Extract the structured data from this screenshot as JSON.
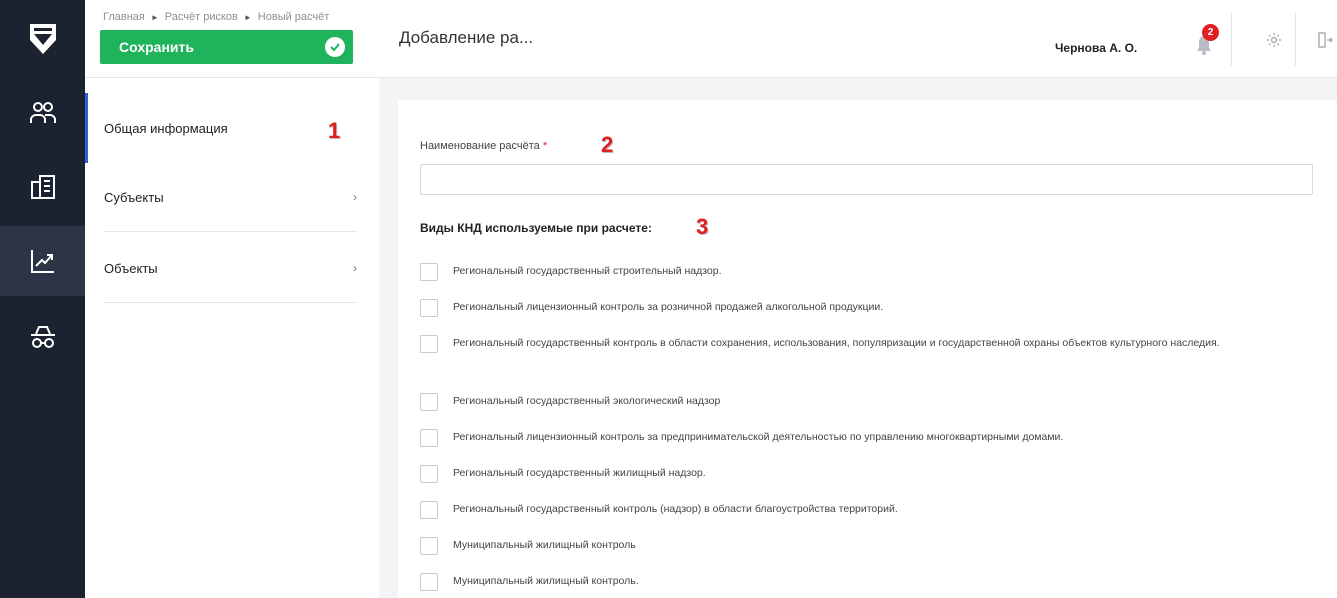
{
  "colors": {
    "rail": "#1b2230",
    "rail_active": "#2c3546",
    "accent_green": "#1fb35b",
    "accent_blue": "#2b62d9",
    "badge_red": "#e02020"
  },
  "rail": {
    "logo_icon": "shield-logo-icon",
    "items": [
      {
        "icon": "users-icon"
      },
      {
        "icon": "building-icon"
      },
      {
        "icon": "chart-trend-icon",
        "active": true
      },
      {
        "icon": "incognito-icon"
      }
    ]
  },
  "header": {
    "breadcrumb": [
      "Главная",
      "Расчёт рисков",
      "Новый расчёт"
    ],
    "save_label": "Сохранить",
    "title": "Добавление ра...",
    "user_name": "Чернова А. О.",
    "notifications_count": "2"
  },
  "subnav": {
    "items": [
      {
        "label": "Общая информация",
        "active": true
      },
      {
        "label": "Субъекты",
        "chevron": "›"
      },
      {
        "label": "Объекты",
        "chevron": "›"
      }
    ]
  },
  "markers": {
    "m1": "1",
    "m2": "2",
    "m3": "3"
  },
  "form": {
    "name_label": "Наименование расчёта",
    "required_mark": "*",
    "name_value": "",
    "knd_title": "Виды КНД используемые при расчете:",
    "knd_options": [
      "Региональный государственный строительный надзор.",
      "Региональный лицензионный контроль за розничной продажей алкогольной продукции.",
      "Региональный государственный контроль в области сохранения, использования, популяризации и государственной охраны объектов культурного наследия.",
      "Региональный государственный экологический надзор",
      "Региональный лицензионный контроль за предпринимательской деятельностью по управлению многоквартирными домами.",
      "Региональный государственный жилищный надзор.",
      "Региональный государственный контроль (надзор) в области благоустройства территорий.",
      "Муниципальный жилищный контроль",
      "Муниципальный жилищный контроль."
    ]
  }
}
